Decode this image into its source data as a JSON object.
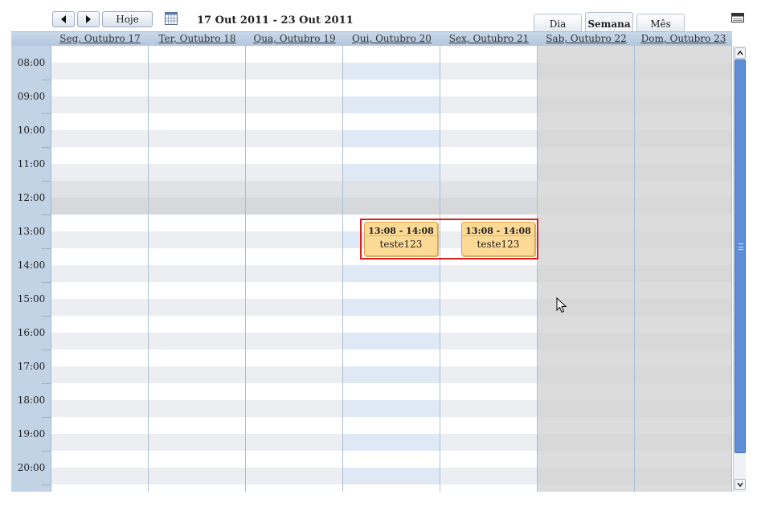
{
  "toolbar": {
    "prev_icon": "triangle-left-icon",
    "next_icon": "triangle-right-icon",
    "today_label": "Hoje",
    "calendar_icon": "calendar-grid-icon",
    "date_range": "17 Out 2011 - 23 Out 2011",
    "views": [
      {
        "label": "Dia",
        "active": false
      },
      {
        "label": "Semana",
        "active": true
      },
      {
        "label": "Mês",
        "active": false
      }
    ],
    "minimize_icon": "window-minimize-icon"
  },
  "days": [
    {
      "label": "Seg, Outubro 17",
      "weekend": false
    },
    {
      "label": "Ter, Outubro 18",
      "weekend": false
    },
    {
      "label": "Qua, Outubro 19",
      "weekend": false
    },
    {
      "label": "Qui, Outubro 20",
      "weekend": false
    },
    {
      "label": "Sex, Outubro 21",
      "weekend": false
    },
    {
      "label": "Sab, Outubro 22",
      "weekend": true
    },
    {
      "label": "Dom, Outubro 23",
      "weekend": true
    }
  ],
  "times": [
    "08:00",
    "09:00",
    "10:00",
    "11:00",
    "12:00",
    "13:00",
    "14:00",
    "15:00",
    "16:00",
    "17:00",
    "18:00",
    "19:00",
    "20:00"
  ],
  "events": [
    {
      "day_index": 3,
      "time": "13:08 - 14:08",
      "title": "teste123"
    },
    {
      "day_index": 4,
      "time": "13:08 - 14:08",
      "title": "teste123"
    }
  ],
  "colors": {
    "accent": "#5f8ed6",
    "header_band": "#c3d3e6",
    "event_fill": "#fcd995",
    "highlight": "#d42020",
    "today_tint": "#dfe8f5",
    "weekend": "#dcdcdc"
  },
  "cursor_icon": "mouse-pointer-icon"
}
